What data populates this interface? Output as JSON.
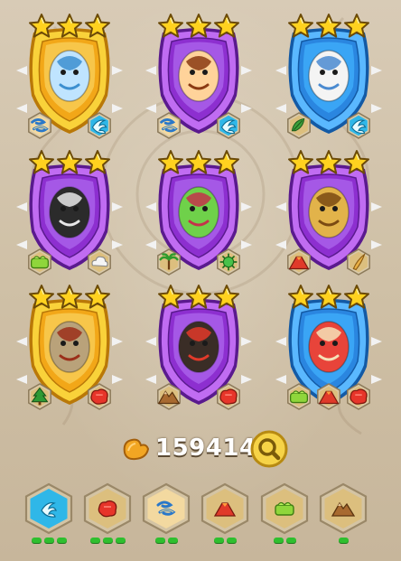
{
  "cards": [
    {
      "frame": "gold",
      "creature": "ice-dragon",
      "stars": 3,
      "elements": [
        "wind",
        "air"
      ]
    },
    {
      "frame": "purple",
      "creature": "flame-wing-dragon",
      "stars": 3,
      "elements": [
        "wind",
        "air"
      ]
    },
    {
      "frame": "blue",
      "creature": "white-griffin",
      "stars": 3,
      "elements": [
        "nature",
        "air"
      ]
    },
    {
      "frame": "purple",
      "creature": "dark-horned-beast",
      "stars": 3,
      "elements": [
        "plant",
        "cloud"
      ]
    },
    {
      "frame": "purple",
      "creature": "carnivorous-plant",
      "stars": 3,
      "elements": [
        "palm",
        "virus"
      ]
    },
    {
      "frame": "purple",
      "creature": "golden-lion",
      "stars": 3,
      "elements": [
        "volcano",
        "claw"
      ]
    },
    {
      "frame": "gold",
      "creature": "bone-dragon",
      "stars": 3,
      "elements": [
        "forest",
        "fire-rock"
      ]
    },
    {
      "frame": "purple",
      "creature": "lava-spike-dragon",
      "stars": 3,
      "elements": [
        "mountain",
        "fire-rock"
      ]
    },
    {
      "frame": "blue",
      "creature": "red-dragon",
      "stars": 3,
      "elements": [
        "plant",
        "volcano",
        "fire-rock"
      ]
    }
  ],
  "gold": {
    "value": "159414",
    "icon": "food-icon"
  },
  "search": {
    "icon": "magnifier-icon"
  },
  "filters": [
    {
      "element": "air",
      "pips": 3
    },
    {
      "element": "fire-rock",
      "pips": 3
    },
    {
      "element": "wind",
      "pips": 2
    },
    {
      "element": "volcano",
      "pips": 2
    },
    {
      "element": "plant",
      "pips": 2
    },
    {
      "element": "mountain",
      "pips": 1
    }
  ],
  "colors": {
    "gold_frame": "#f4c21a",
    "purple_frame": "#a13fe0",
    "blue_frame": "#2f9cf0",
    "pip": "#2fbf2f",
    "star": "#ffd21f"
  }
}
